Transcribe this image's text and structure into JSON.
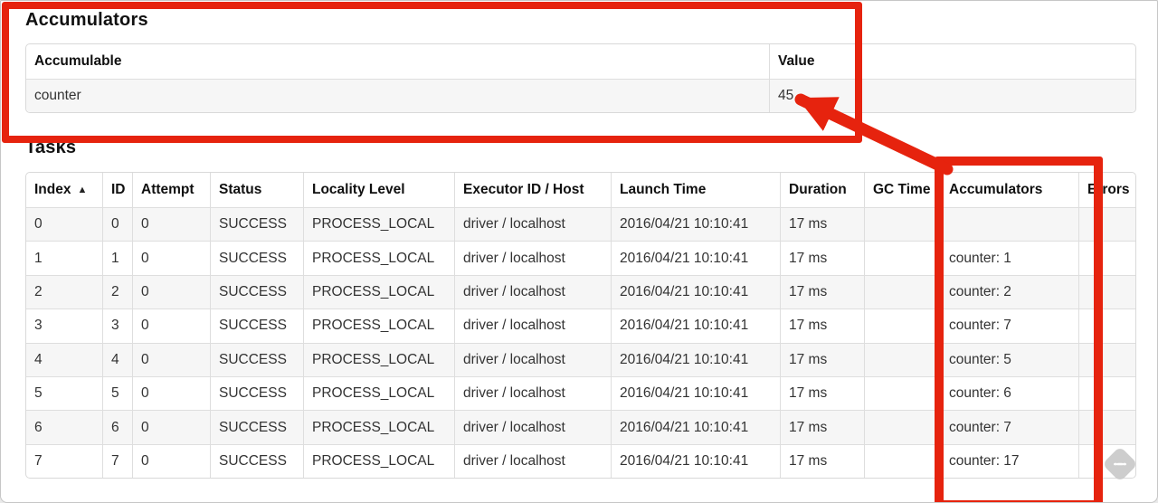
{
  "accumulators_section": {
    "title": "Accumulators",
    "table": {
      "headers": [
        "Accumulable",
        "Value"
      ],
      "rows": [
        [
          "counter",
          "45"
        ]
      ]
    }
  },
  "tasks_section": {
    "title": "Tasks",
    "table": {
      "headers": [
        "Index",
        "ID",
        "Attempt",
        "Status",
        "Locality Level",
        "Executor ID / Host",
        "Launch Time",
        "Duration",
        "GC Time",
        "Accumulators",
        "Errors"
      ],
      "sort_icon": "▲",
      "rows": [
        [
          "0",
          "0",
          "0",
          "SUCCESS",
          "PROCESS_LOCAL",
          "driver / localhost",
          "2016/04/21 10:10:41",
          "17 ms",
          "",
          "",
          ""
        ],
        [
          "1",
          "1",
          "0",
          "SUCCESS",
          "PROCESS_LOCAL",
          "driver / localhost",
          "2016/04/21 10:10:41",
          "17 ms",
          "",
          "counter: 1",
          ""
        ],
        [
          "2",
          "2",
          "0",
          "SUCCESS",
          "PROCESS_LOCAL",
          "driver / localhost",
          "2016/04/21 10:10:41",
          "17 ms",
          "",
          "counter: 2",
          ""
        ],
        [
          "3",
          "3",
          "0",
          "SUCCESS",
          "PROCESS_LOCAL",
          "driver / localhost",
          "2016/04/21 10:10:41",
          "17 ms",
          "",
          "counter: 7",
          ""
        ],
        [
          "4",
          "4",
          "0",
          "SUCCESS",
          "PROCESS_LOCAL",
          "driver / localhost",
          "2016/04/21 10:10:41",
          "17 ms",
          "",
          "counter: 5",
          ""
        ],
        [
          "5",
          "5",
          "0",
          "SUCCESS",
          "PROCESS_LOCAL",
          "driver / localhost",
          "2016/04/21 10:10:41",
          "17 ms",
          "",
          "counter: 6",
          ""
        ],
        [
          "6",
          "6",
          "0",
          "SUCCESS",
          "PROCESS_LOCAL",
          "driver / localhost",
          "2016/04/21 10:10:41",
          "17 ms",
          "",
          "counter: 7",
          ""
        ],
        [
          "7",
          "7",
          "0",
          "SUCCESS",
          "PROCESS_LOCAL",
          "driver / localhost",
          "2016/04/21 10:10:41",
          "17 ms",
          "",
          "counter: 17",
          ""
        ]
      ]
    }
  },
  "annotations": {
    "color": "#e6230e"
  },
  "watermark": {
    "icon": "pencil-icon"
  }
}
